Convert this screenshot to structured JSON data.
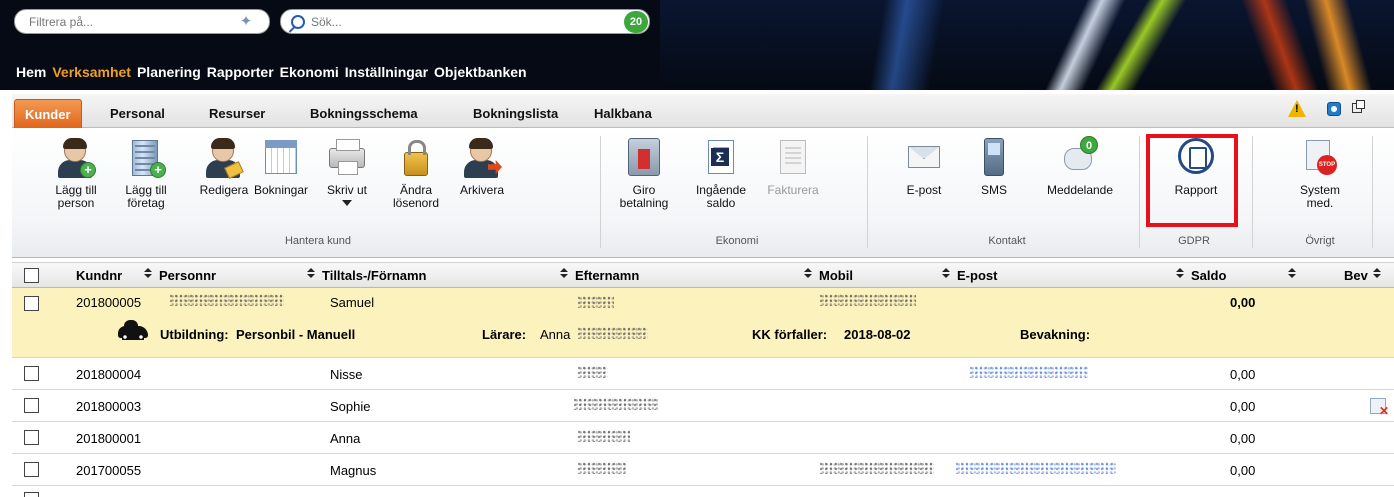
{
  "header": {
    "filter_placeholder": "Filtrera på...",
    "search_placeholder": "Sök...",
    "result_count": "20",
    "nav": [
      "Hem",
      "Verksamhet",
      "Planering",
      "Rapporter",
      "Ekonomi",
      "Inställningar",
      "Objektbanken"
    ],
    "active_nav": "Verksamhet"
  },
  "tabs": {
    "items": [
      "Kunder",
      "Personal",
      "Resurser",
      "Bokningsschema",
      "Bokningslista",
      "Halkbana"
    ],
    "active": "Kunder"
  },
  "ribbon": {
    "buttons": {
      "add_person": "Lägg till person",
      "add_company": "Lägg till företag",
      "edit": "Redigera",
      "bookings": "Bokningar",
      "print": "Skriv ut",
      "change_password": "Ändra lösenord",
      "archive": "Arkivera",
      "giro": "Giro betalning",
      "opening_balance": "Ingående saldo",
      "invoice": "Fakturera",
      "email": "E-post",
      "sms": "SMS",
      "message": "Meddelande",
      "message_badge": "0",
      "report": "Rapport",
      "system_message": "System med."
    },
    "groups": {
      "manage_customer": "Hantera kund",
      "economy": "Ekonomi",
      "contact": "Kontakt",
      "gdpr": "GDPR",
      "other": "Övrigt"
    }
  },
  "table": {
    "columns": {
      "customer_no": "Kundnr",
      "person_no": "Personnr",
      "first_name": "Tilltals-/Förnamn",
      "last_name": "Efternamn",
      "mobile": "Mobil",
      "email": "E-post",
      "balance": "Saldo",
      "bev": "Bev"
    },
    "selected_detail": {
      "education_label": "Utbildning:",
      "education_value": "Personbil - Manuell",
      "teacher_label": "Lärare:",
      "teacher_value": "Anna",
      "kk_label": "KK förfaller:",
      "kk_value": "2018-08-02",
      "watch_label": "Bevakning:"
    },
    "rows": [
      {
        "customer_no": "201800005",
        "first_name": "Samuel",
        "balance": "0,00"
      },
      {
        "customer_no": "201800004",
        "first_name": "Nisse",
        "balance": "0,00"
      },
      {
        "customer_no": "201800003",
        "first_name": "Sophie",
        "balance": "0,00"
      },
      {
        "customer_no": "201800001",
        "first_name": "Anna",
        "balance": "0,00"
      },
      {
        "customer_no": "201700055",
        "first_name": "Magnus",
        "balance": "0,00"
      }
    ]
  },
  "colors": {
    "header_bg": "#050a14",
    "active_nav": "#f0a020",
    "active_tab": "#e2661c",
    "selected_row": "#fcf2bd",
    "gdpr_highlight": "#e8101a",
    "count_badge": "#3ca83c"
  }
}
